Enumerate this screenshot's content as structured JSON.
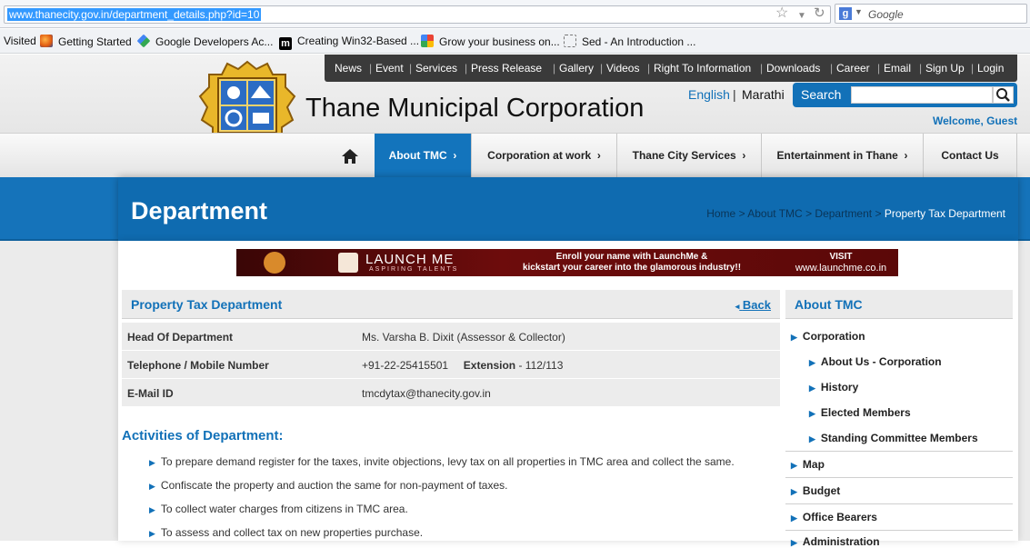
{
  "browser": {
    "url": "www.thanecity.gov.in/department_details.php?id=10",
    "search_placeholder": "Google",
    "search_engine_logo": "g",
    "bookmarks": [
      {
        "label": "Visited",
        "icon": ""
      },
      {
        "label": "Getting Started",
        "icon": "firefox-icon"
      },
      {
        "label": "Google Developers Ac...",
        "icon": "google-developers-icon"
      },
      {
        "label": "Creating Win32-Based ...",
        "icon": "m-icon"
      },
      {
        "label": "Grow your business on...",
        "icon": "google-plus-icon"
      },
      {
        "label": "Sed - An Introduction ...",
        "icon": "blank-page-icon"
      }
    ]
  },
  "site": {
    "top_nav": [
      "News",
      "Event",
      "Services",
      "Press Release",
      "Gallery",
      "Videos",
      "Right To Information",
      "Downloads",
      "Career",
      "Email",
      "Sign Up",
      "Login"
    ],
    "title": "Thane Municipal Corporation",
    "lang_en": "English",
    "lang_sep": "|",
    "lang_mr": "Marathi",
    "search_label": "Search",
    "welcome": "Welcome, Guest",
    "main_nav": [
      "About TMC",
      "Corporation at work",
      "Thane City Services",
      "Entertainment in Thane",
      "Contact Us"
    ],
    "page_title": "Department",
    "breadcrumb": {
      "home": "Home",
      "about": "About TMC",
      "department": "Department",
      "current": "Property Tax Department",
      "sep": ">"
    }
  },
  "ad": {
    "brand": "LAUNCH ME",
    "tagline": "ASPIRING TALENTS",
    "message_line1": "Enroll your name with LaunchMe &",
    "message_line2": "kickstart your career into the glamorous industry!!",
    "visit": "VISIT",
    "url": "www.launchme.co.in"
  },
  "department": {
    "title": "Property Tax Department",
    "back": "Back",
    "rows": [
      {
        "key": "Head Of Department",
        "value": "Ms. Varsha B. Dixit (Assessor & Collector)"
      },
      {
        "key": "Telephone / Mobile Number",
        "value": "+91-22-25415501",
        "ext_label": "Extension",
        "ext_value": "- 112/113"
      },
      {
        "key": "E-Mail ID",
        "value": "tmcdytax@thanecity.gov.in"
      }
    ],
    "activities_title": "Activities of Department:",
    "activities": [
      "To prepare demand register for the taxes, invite objections, levy tax on all properties in TMC area and collect the same.",
      "Confiscate the property and auction the same for non-payment of taxes.",
      "To collect water charges from citizens in TMC area.",
      "To assess and collect tax on new properties purchase."
    ]
  },
  "sidebar": {
    "title": "About TMC",
    "corporation": "Corporation",
    "sub_items": [
      "About Us - Corporation",
      "History",
      "Elected Members",
      "Standing Committee Members"
    ],
    "items": [
      "Map",
      "Budget",
      "Office Bearers",
      "Administration"
    ]
  },
  "colors": {
    "brand_blue": "#1271b8",
    "banner_blue": "#1573ba",
    "top_nav_bg": "#3a3a3a",
    "ad_bg": "#6d0c0c"
  }
}
